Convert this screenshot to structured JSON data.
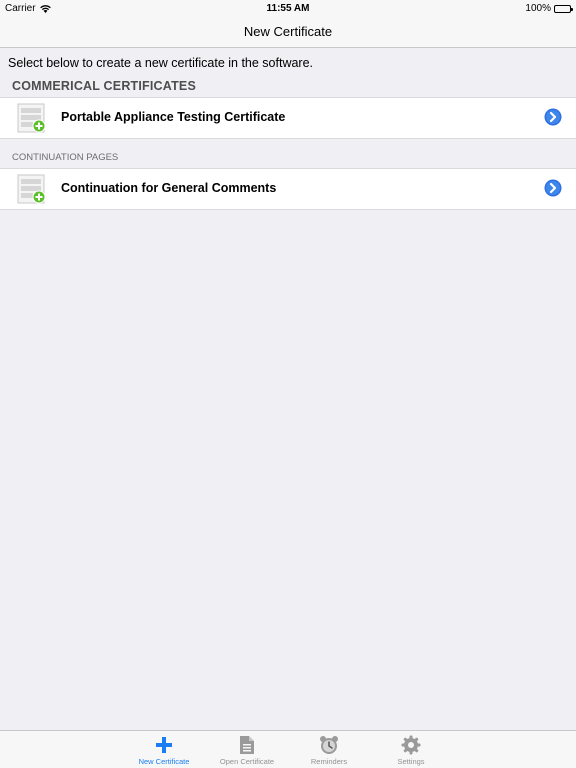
{
  "status_bar": {
    "carrier": "Carrier",
    "time": "11:55 AM",
    "battery": "100%"
  },
  "nav": {
    "title": "New Certificate"
  },
  "intro_text": "Select below to create a new certificate in the software.",
  "sections": [
    {
      "header": "COMMERICAL CERTIFICATES",
      "items": [
        {
          "label": "Portable Appliance Testing Certificate",
          "icon": "new-document-icon"
        }
      ]
    },
    {
      "header": "CONTINUATION PAGES",
      "items": [
        {
          "label": "Continuation for General Comments",
          "icon": "new-document-icon"
        }
      ]
    }
  ],
  "tab_bar": {
    "active": 0,
    "tabs": [
      {
        "label": "New Certificate",
        "icon": "plus-icon"
      },
      {
        "label": "Open Certificate",
        "icon": "document-icon"
      },
      {
        "label": "Reminders",
        "icon": "alarm-clock-icon"
      },
      {
        "label": "Settings",
        "icon": "gear-icon"
      }
    ]
  },
  "colors": {
    "accent": "#1a7ef2",
    "background": "#efeff4",
    "disclosure": "#2f6fe0",
    "add_badge": "#5cbf2a"
  }
}
